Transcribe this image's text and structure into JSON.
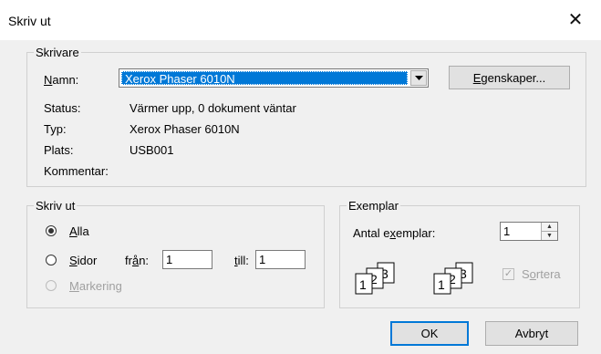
{
  "window": {
    "title": "Skriv ut"
  },
  "printer": {
    "group_label": "Skrivare",
    "name_label": "Namn:",
    "name_value": "Xerox Phaser 6010N",
    "properties_button": "Egenskaper...",
    "status_label": "Status:",
    "status_value": "Värmer upp, 0 dokument väntar",
    "type_label": "Typ:",
    "type_value": "Xerox Phaser 6010N",
    "location_label": "Plats:",
    "location_value": "USB001",
    "comment_label": "Kommentar:"
  },
  "print_range": {
    "group_label": "Skriv ut",
    "all_label": "Alla",
    "pages_label": "Sidor",
    "from_label": "från:",
    "from_value": "1",
    "to_label": "till:",
    "to_value": "1",
    "selection_label": "Markering",
    "selected": "all"
  },
  "copies": {
    "group_label": "Exemplar",
    "count_label": "Antal exemplar:",
    "count_value": "1",
    "collate_label": "Sortera",
    "collate_checked": true,
    "collate_enabled": false,
    "collate_icon": "collate-pages-icon"
  },
  "actions": {
    "ok": "OK",
    "cancel": "Avbryt"
  }
}
